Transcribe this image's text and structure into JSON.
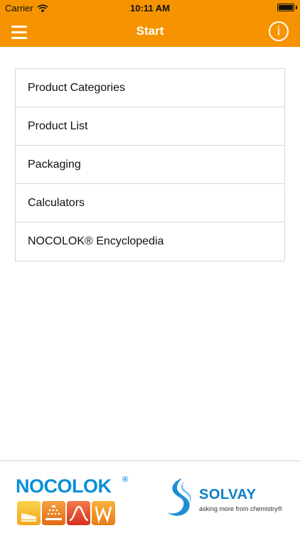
{
  "status_bar": {
    "carrier": "Carrier",
    "time": "10:11 AM",
    "wifi_icon": "wifi-icon",
    "battery_icon": "battery-icon"
  },
  "nav_bar": {
    "title": "Start",
    "menu_icon": "hamburger-menu-icon",
    "info_icon": "info-icon",
    "info_glyph": "i",
    "background_color": "#f59400"
  },
  "menu": {
    "items": [
      {
        "label": "Product Categories"
      },
      {
        "label": "Product List"
      },
      {
        "label": "Packaging"
      },
      {
        "label": "Calculators"
      },
      {
        "label": "NOCOLOK® Encyclopedia"
      }
    ]
  },
  "footer": {
    "nocolok": {
      "wordmark": "NOCOLOK",
      "registered": "®",
      "brand_color": "#0a8fd8"
    },
    "solvay": {
      "wordmark": "SOLVAY",
      "tagline": "asking more from chemistry®",
      "brand_color": "#0a7fc8"
    }
  }
}
